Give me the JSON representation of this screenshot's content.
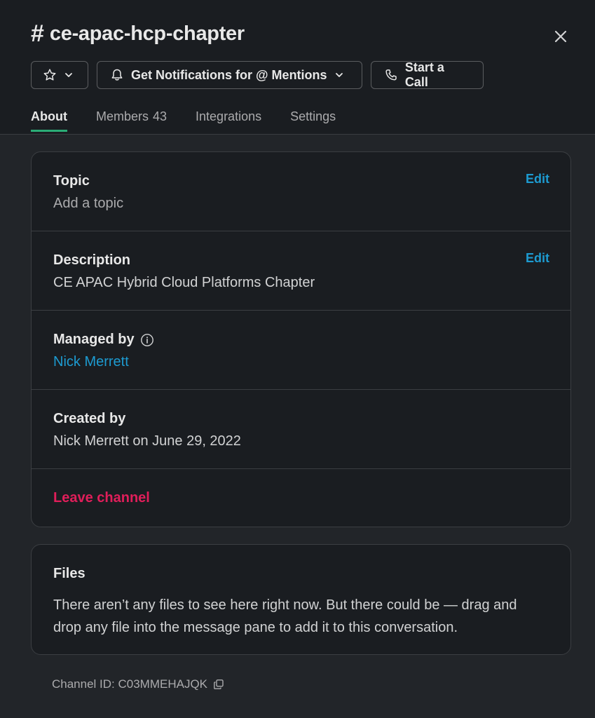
{
  "header": {
    "hash": "#",
    "title": "ce-apac-hcp-chapter",
    "notifications_label": "Get Notifications for @ Mentions",
    "call_label": "Start a Call"
  },
  "tabs": [
    {
      "label": "About",
      "active": true
    },
    {
      "label": "Members",
      "count": "43"
    },
    {
      "label": "Integrations"
    },
    {
      "label": "Settings"
    }
  ],
  "about": {
    "topic": {
      "label": "Topic",
      "value": "Add a topic",
      "edit": "Edit"
    },
    "description": {
      "label": "Description",
      "value": "CE APAC Hybrid Cloud Platforms Chapter",
      "edit": "Edit"
    },
    "managed_by": {
      "label": "Managed by",
      "value": "Nick Merrett"
    },
    "created_by": {
      "label": "Created by",
      "value": "Nick Merrett on June 29, 2022"
    },
    "leave": "Leave channel"
  },
  "files": {
    "title": "Files",
    "text": "There aren’t any files to see here right now. But there could be — drag and drop any file into the message pane to add it to this conversation."
  },
  "channel_id": "Channel ID: C03MMEHAJQK",
  "colors": {
    "accent_link": "#1d9bd1",
    "danger": "#e01e5a",
    "active_tab": "#2bac76"
  },
  "icons": [
    "star-icon",
    "chevron-down-icon",
    "bell-icon",
    "phone-icon",
    "close-icon",
    "info-icon",
    "copy-icon"
  ]
}
